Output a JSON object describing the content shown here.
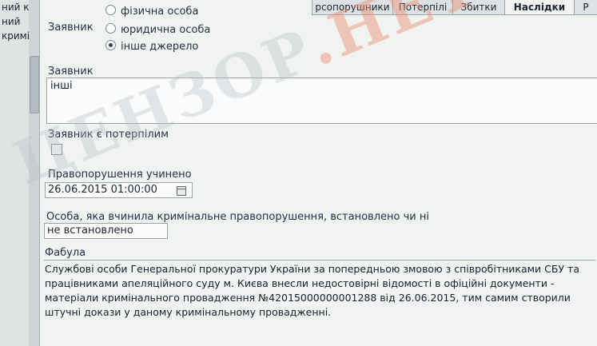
{
  "left_panel": {
    "lines": [
      "ний к",
      "ний",
      "кримін"
    ]
  },
  "tabs": [
    {
      "label": "рсопорушники"
    },
    {
      "label": "Потерпілі"
    },
    {
      "label": "Збитки"
    },
    {
      "label": "Наслідки"
    },
    {
      "label": "Р"
    }
  ],
  "applicant_type": {
    "label": "Заявник",
    "options": [
      {
        "label": "фізична особа",
        "checked": false
      },
      {
        "label": "юридична особа",
        "checked": false
      },
      {
        "label": "інше джерело",
        "checked": true
      }
    ]
  },
  "applicant": {
    "label": "Заявник",
    "value": "інші"
  },
  "applicant_is_victim": {
    "label": "Заявник є потерпілим",
    "checked": false
  },
  "offense_date": {
    "label": "Правопорушення учинено",
    "value": "26.06.2015 01:00:00"
  },
  "offender": {
    "label": "Особа, яка вчинила кримінальне правопорушення, встановлено чи ні",
    "value": "не встановлено особу"
  },
  "fabula": {
    "label": "Фабула",
    "text": "Службові особи Генеральної прокуратури України за попередньою змовою з співробітниками СБУ та працівниками апеляційного суду м. Києва внесли недостовірні відомості в офіційні документи - матеріали кримінального провадження №42015000000001288 від 26.06.2015, тим самим створили штучні докази у даному кримінальному провадженні."
  },
  "watermark": {
    "main": "ЦЕНЗОР",
    "accent": ".НЕТ"
  },
  "colors": {
    "background": "#f1f3f1",
    "text": "#1e2a3a",
    "field_border": "#9aa3a8"
  }
}
